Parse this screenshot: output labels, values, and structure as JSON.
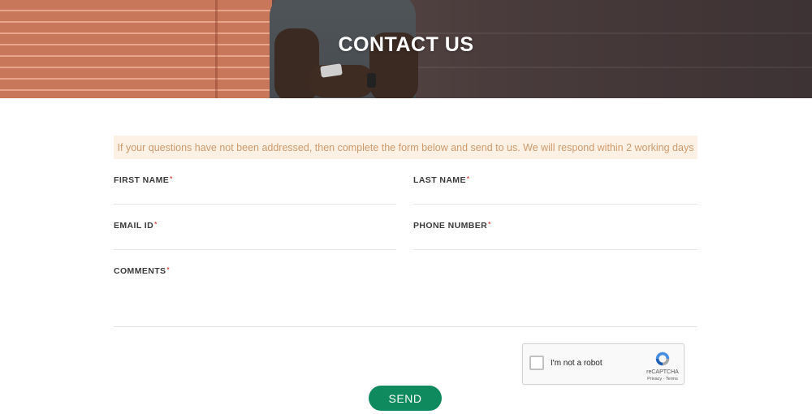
{
  "hero": {
    "title": "CONTACT US"
  },
  "notice": {
    "text": "If your questions have not been addressed, then complete the form below and send to us. We will respond within 2 working days"
  },
  "form": {
    "first_name": {
      "label": "FIRST NAME",
      "required": "*",
      "value": ""
    },
    "last_name": {
      "label": "LAST NAME",
      "required": "*",
      "value": ""
    },
    "email": {
      "label": "EMAIL ID",
      "required": "*",
      "value": ""
    },
    "phone": {
      "label": "PHONE NUMBER",
      "required": "*",
      "value": ""
    },
    "comments": {
      "label": "COMMENTS",
      "required": "*",
      "value": ""
    }
  },
  "captcha": {
    "label": "I'm not a robot",
    "brand": "reCAPTCHA",
    "links": "Privacy - Terms",
    "icon": "recaptcha-logo-icon"
  },
  "send_label": "SEND",
  "colors": {
    "send_button": "#0f8a5f",
    "notice_bg": "#fdf1e5",
    "notice_text": "#cf9a6d",
    "required_mark": "#d9534f"
  }
}
